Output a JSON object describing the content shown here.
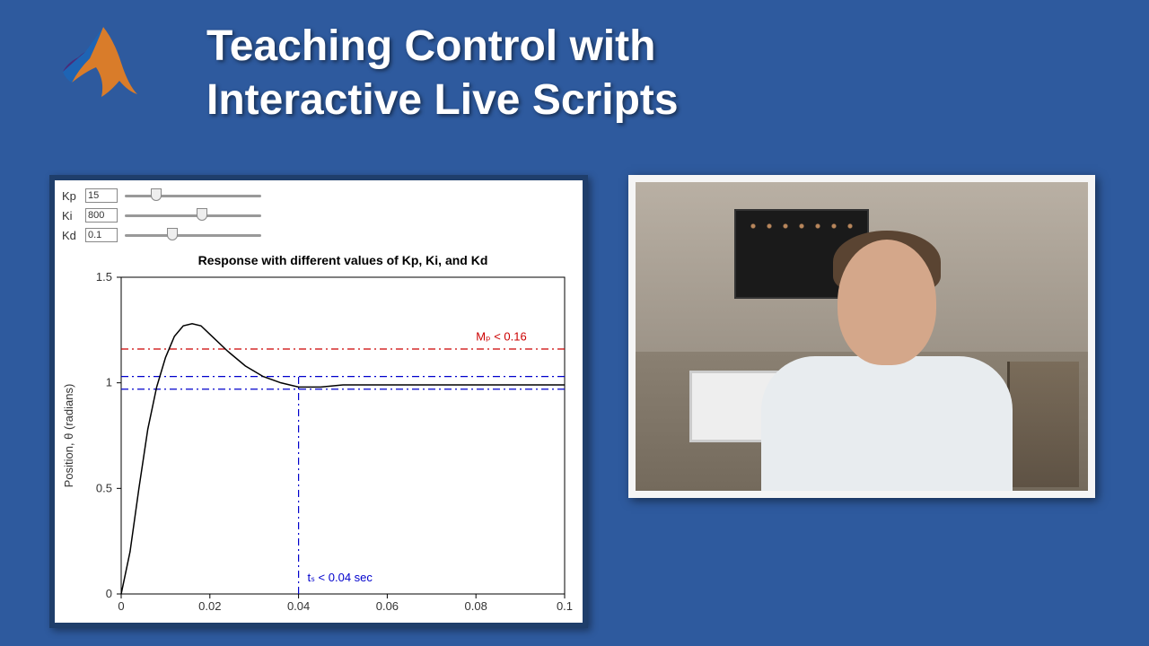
{
  "page_title": "Teaching Control with\nInteractive Live Scripts",
  "sliders": {
    "kp": {
      "label": "Kp",
      "value": "15",
      "thumb_pct": 22
    },
    "ki": {
      "label": "Ki",
      "value": "800",
      "thumb_pct": 56
    },
    "kd": {
      "label": "Kd",
      "value": "0.1",
      "thumb_pct": 34
    }
  },
  "chart_data": {
    "type": "line",
    "title": "Response with different values of Kp, Ki, and Kd",
    "xlabel": "",
    "ylabel": "Position, θ (radians)",
    "xlim": [
      0,
      0.1
    ],
    "ylim": [
      0,
      1.5
    ],
    "xticks": [
      0,
      0.02,
      0.04,
      0.06,
      0.08,
      0.1
    ],
    "yticks": [
      0,
      0.5,
      1,
      1.5
    ],
    "series": [
      {
        "name": "response",
        "color": "#000000",
        "style": "solid",
        "x": [
          0,
          0.002,
          0.004,
          0.006,
          0.008,
          0.01,
          0.012,
          0.014,
          0.016,
          0.018,
          0.02,
          0.024,
          0.028,
          0.032,
          0.036,
          0.04,
          0.045,
          0.05,
          0.06,
          0.07,
          0.08,
          0.09,
          0.1
        ],
        "y": [
          0,
          0.2,
          0.5,
          0.78,
          0.98,
          1.12,
          1.22,
          1.27,
          1.28,
          1.27,
          1.23,
          1.15,
          1.08,
          1.03,
          1.0,
          0.98,
          0.98,
          0.99,
          0.99,
          0.99,
          0.99,
          0.99,
          0.99
        ]
      }
    ],
    "reference_lines": [
      {
        "type": "hline",
        "y": 1.16,
        "color": "#cc0000",
        "style": "dashdot",
        "label": "Mₚ < 0.16"
      },
      {
        "type": "hline",
        "y": 1.03,
        "color": "#0000cc",
        "style": "dashdot"
      },
      {
        "type": "hline",
        "y": 0.97,
        "color": "#0000cc",
        "style": "dashdot"
      },
      {
        "type": "vline",
        "x": 0.04,
        "ymax": 1.03,
        "color": "#0000cc",
        "style": "dashdot",
        "label": "tₛ < 0.04 sec"
      }
    ],
    "annotations": [
      {
        "text": "Mₚ < 0.16",
        "x": 0.08,
        "y": 1.2,
        "color": "#cc0000"
      },
      {
        "text": "tₛ < 0.04 sec",
        "x": 0.042,
        "y": 0.06,
        "color": "#0000cc"
      }
    ]
  }
}
